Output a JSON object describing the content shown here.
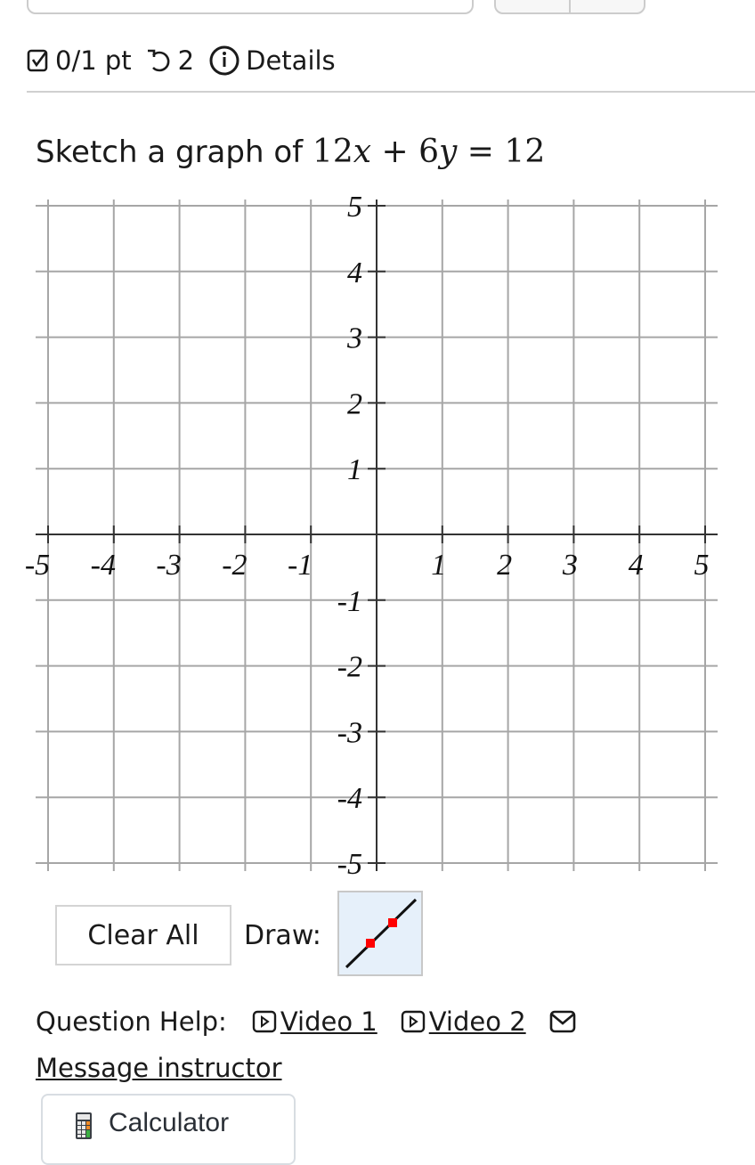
{
  "header": {
    "score": "0/1 pt",
    "retries": "2",
    "details_label": "Details",
    "icons": {
      "score": "checkbox-icon",
      "retries": "retry-icon",
      "details": "info-icon"
    }
  },
  "question": {
    "prefix": "Sketch a graph of ",
    "equation_parts": [
      "12",
      "x",
      " + 6",
      "y",
      " = 12"
    ]
  },
  "graph": {
    "x_ticks": [
      "-5",
      "-4",
      "-3",
      "-2",
      "-1",
      "1",
      "2",
      "3",
      "4",
      "5"
    ],
    "y_ticks": [
      "5",
      "4",
      "3",
      "2",
      "1",
      "-1",
      "-2",
      "-3",
      "-4",
      "-5"
    ],
    "x_range": [
      -5,
      5
    ],
    "y_range": [
      -5,
      5
    ],
    "grid": true,
    "colors": {
      "grid": "#a6a6a6",
      "axis": "#333333"
    }
  },
  "controls": {
    "clear_label": "Clear All",
    "draw_label": "Draw:",
    "tool": "line-tool",
    "tool_colors": {
      "background": "#e6f0fa",
      "points": "#ff0000",
      "line": "#111111"
    }
  },
  "help": {
    "label": "Question Help:",
    "video1": "Video 1",
    "video2": "Video 2",
    "message": "Message instructor"
  },
  "calculator": {
    "label": "Calculator"
  }
}
